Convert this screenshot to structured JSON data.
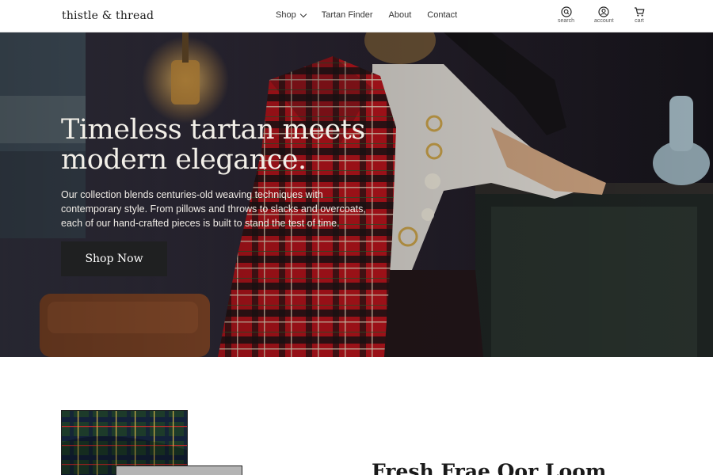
{
  "header": {
    "logo": "thistle & thread",
    "nav": [
      {
        "label": "Shop",
        "has_dropdown": true
      },
      {
        "label": "Tartan Finder"
      },
      {
        "label": "About"
      },
      {
        "label": "Contact"
      }
    ],
    "utilities": [
      {
        "label": "search",
        "icon": "search-icon"
      },
      {
        "label": "account",
        "icon": "user-icon"
      },
      {
        "label": "cart",
        "icon": "cart-icon"
      }
    ]
  },
  "hero": {
    "headline_line1": "Timeless tartan meets",
    "headline_line2": "modern elegance.",
    "subtext": "Our collection blends centuries-old weaving techniques with contemporary style. From pillows and throws to slacks and overcoats, each of our hand-crafted pieces is built to stand the test of time.",
    "cta_label": "Shop Now"
  },
  "section": {
    "title": "Fresh Frae Oor Loom"
  },
  "colors": {
    "cta_background": "#1f2021",
    "tartan_red": "#b8141c",
    "hero_dark": "#1d1a22"
  }
}
